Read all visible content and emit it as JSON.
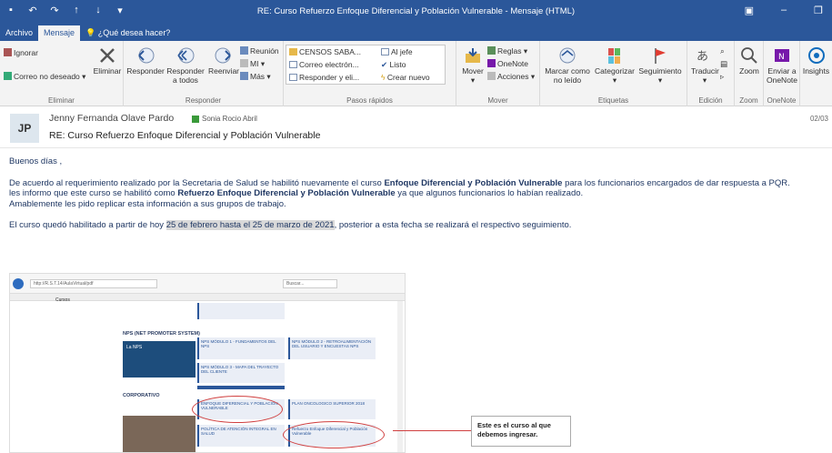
{
  "window": {
    "title": "RE: Curso Refuerzo Enfoque Diferencial y Población Vulnerable - Mensaje (HTML)"
  },
  "tabs": [
    "Archivo",
    "Mensaje"
  ],
  "tell_me": "¿Qué desea hacer?",
  "ribbon": {
    "eliminar": {
      "ignorar": "Ignorar",
      "correo_no_deseado": "Correo no deseado",
      "eliminar": "Eliminar",
      "label": "Eliminar"
    },
    "responder": {
      "responder": "Responder",
      "responder_todos": "Responder a todos",
      "reenviar": "Reenviar",
      "reunion": "Reunión",
      "mi": "MI",
      "mas": "Más",
      "label": "Responder"
    },
    "pasos_rapidos": {
      "items": [
        "CENSOS SABA...",
        "Al jefe",
        "Correo electrón...",
        "Listo",
        "Responder y eli...",
        "Crear nuevo"
      ],
      "label": "Pasos rápidos"
    },
    "mover": {
      "mover": "Mover",
      "reglas": "Reglas",
      "onenote": "OneNote",
      "acciones": "Acciones",
      "label": "Mover"
    },
    "etiquetas": {
      "marcar": "Marcar como no leído",
      "categorizar": "Categorizar",
      "seguimiento": "Seguimiento",
      "label": "Etiquetas"
    },
    "edicion": {
      "traducir": "Traducir",
      "label": "Edición"
    },
    "zoom": {
      "zoom": "Zoom",
      "label": "Zoom"
    },
    "onenote": {
      "enviar": "Enviar a OneNote",
      "label": "OneNote"
    },
    "insights": "Insights"
  },
  "message": {
    "avatar": "JP",
    "sender": "Jenny Fernanda Olave Pardo",
    "to": "Sonia Rocio Abril",
    "date": "02/03",
    "subject": "RE: Curso Refuerzo Enfoque Diferencial y Población Vulnerable",
    "greeting": "Buenos días ,",
    "p1_a": "De acuerdo al requerimiento realizado  por la Secretaria de Salud se habilitó nuevamente el curso ",
    "p1_bold": "Enfoque Diferencial y Población Vulnerable",
    "p1_b": " para los funcionarios encargados de dar respuesta a PQR.",
    "p2_a": "les informo que este curso se habilitó como ",
    "p2_bold": "Refuerzo Enfoque Diferencial y Población Vulnerable",
    "p2_b": " ya que algunos funcionarios  lo habían realizado.",
    "p3": "Amablemente les pido replicar esta información a sus grupos de trabajo.",
    "p4_a": "El curso quedó habilitado a partir de hoy ",
    "p4_hl": "25 de febrero hasta el 25 de marzo de 2021",
    "p4_b": ", posterior a esta fecha se realizará el respectivo seguimiento."
  },
  "embedded": {
    "address": "http://R.S.T.14/AulaVirtual/pdf",
    "search": "Buscar...",
    "tab_label": "Cursos",
    "section_nps": "NPS (NET PROMOTER SYSTEM)",
    "section_corp": "CORPORATIVO",
    "nps_logo": "La NPS",
    "card_nps1": "NPS MÓDULO 1 - FUNDAMENTOS DEL NPS",
    "card_nps2": "NPS MÓDULO 2 - RETROALIMENTACIÓN DEL USUARIO Y ENCUESTAS NPS",
    "card_nps3": "NPS MÓDULO 3 - MAPA DEL TRAYECTO DEL CLIENTE",
    "card_enfoque": "ENFOQUE DIFERENCIAL Y POBLACIÓN VULNERABLE",
    "card_plan": "PLAN ONCOLOGICO SUPERIOR 2018",
    "card_politica": "POLÍTICA DE ATENCIÓN INTEGRAL EN SALUD",
    "card_refuerzo": "Refuerzo Enfoque Diferencial y Población Vulnerable"
  },
  "callout": "Este es el curso al que debemos ingresar."
}
